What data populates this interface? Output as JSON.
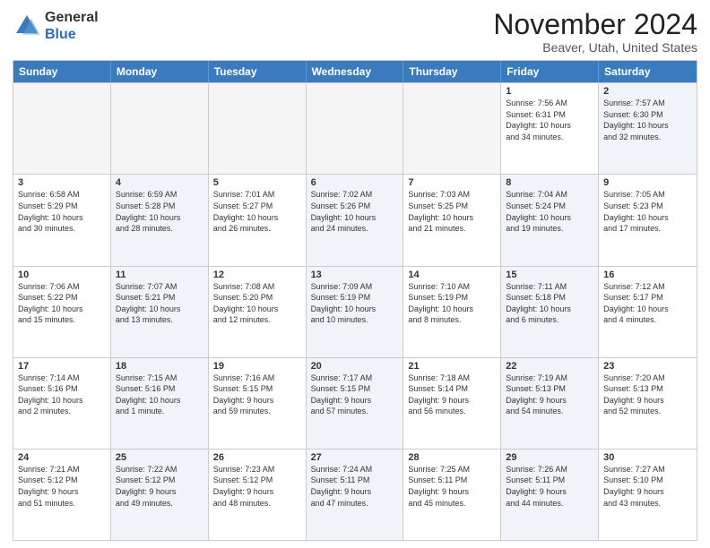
{
  "header": {
    "logo_general": "General",
    "logo_blue": "Blue",
    "month_title": "November 2024",
    "location": "Beaver, Utah, United States"
  },
  "weekdays": [
    "Sunday",
    "Monday",
    "Tuesday",
    "Wednesday",
    "Thursday",
    "Friday",
    "Saturday"
  ],
  "rows": [
    [
      {
        "day": "",
        "info": "",
        "empty": true
      },
      {
        "day": "",
        "info": "",
        "empty": true
      },
      {
        "day": "",
        "info": "",
        "empty": true
      },
      {
        "day": "",
        "info": "",
        "empty": true
      },
      {
        "day": "",
        "info": "",
        "empty": true
      },
      {
        "day": "1",
        "info": "Sunrise: 7:56 AM\nSunset: 6:31 PM\nDaylight: 10 hours\nand 34 minutes.",
        "empty": false,
        "alt": false
      },
      {
        "day": "2",
        "info": "Sunrise: 7:57 AM\nSunset: 6:30 PM\nDaylight: 10 hours\nand 32 minutes.",
        "empty": false,
        "alt": true
      }
    ],
    [
      {
        "day": "3",
        "info": "Sunrise: 6:58 AM\nSunset: 5:29 PM\nDaylight: 10 hours\nand 30 minutes.",
        "empty": false,
        "alt": false
      },
      {
        "day": "4",
        "info": "Sunrise: 6:59 AM\nSunset: 5:28 PM\nDaylight: 10 hours\nand 28 minutes.",
        "empty": false,
        "alt": true
      },
      {
        "day": "5",
        "info": "Sunrise: 7:01 AM\nSunset: 5:27 PM\nDaylight: 10 hours\nand 26 minutes.",
        "empty": false,
        "alt": false
      },
      {
        "day": "6",
        "info": "Sunrise: 7:02 AM\nSunset: 5:26 PM\nDaylight: 10 hours\nand 24 minutes.",
        "empty": false,
        "alt": true
      },
      {
        "day": "7",
        "info": "Sunrise: 7:03 AM\nSunset: 5:25 PM\nDaylight: 10 hours\nand 21 minutes.",
        "empty": false,
        "alt": false
      },
      {
        "day": "8",
        "info": "Sunrise: 7:04 AM\nSunset: 5:24 PM\nDaylight: 10 hours\nand 19 minutes.",
        "empty": false,
        "alt": true
      },
      {
        "day": "9",
        "info": "Sunrise: 7:05 AM\nSunset: 5:23 PM\nDaylight: 10 hours\nand 17 minutes.",
        "empty": false,
        "alt": false
      }
    ],
    [
      {
        "day": "10",
        "info": "Sunrise: 7:06 AM\nSunset: 5:22 PM\nDaylight: 10 hours\nand 15 minutes.",
        "empty": false,
        "alt": false
      },
      {
        "day": "11",
        "info": "Sunrise: 7:07 AM\nSunset: 5:21 PM\nDaylight: 10 hours\nand 13 minutes.",
        "empty": false,
        "alt": true
      },
      {
        "day": "12",
        "info": "Sunrise: 7:08 AM\nSunset: 5:20 PM\nDaylight: 10 hours\nand 12 minutes.",
        "empty": false,
        "alt": false
      },
      {
        "day": "13",
        "info": "Sunrise: 7:09 AM\nSunset: 5:19 PM\nDaylight: 10 hours\nand 10 minutes.",
        "empty": false,
        "alt": true
      },
      {
        "day": "14",
        "info": "Sunrise: 7:10 AM\nSunset: 5:19 PM\nDaylight: 10 hours\nand 8 minutes.",
        "empty": false,
        "alt": false
      },
      {
        "day": "15",
        "info": "Sunrise: 7:11 AM\nSunset: 5:18 PM\nDaylight: 10 hours\nand 6 minutes.",
        "empty": false,
        "alt": true
      },
      {
        "day": "16",
        "info": "Sunrise: 7:12 AM\nSunset: 5:17 PM\nDaylight: 10 hours\nand 4 minutes.",
        "empty": false,
        "alt": false
      }
    ],
    [
      {
        "day": "17",
        "info": "Sunrise: 7:14 AM\nSunset: 5:16 PM\nDaylight: 10 hours\nand 2 minutes.",
        "empty": false,
        "alt": false
      },
      {
        "day": "18",
        "info": "Sunrise: 7:15 AM\nSunset: 5:16 PM\nDaylight: 10 hours\nand 1 minute.",
        "empty": false,
        "alt": true
      },
      {
        "day": "19",
        "info": "Sunrise: 7:16 AM\nSunset: 5:15 PM\nDaylight: 9 hours\nand 59 minutes.",
        "empty": false,
        "alt": false
      },
      {
        "day": "20",
        "info": "Sunrise: 7:17 AM\nSunset: 5:15 PM\nDaylight: 9 hours\nand 57 minutes.",
        "empty": false,
        "alt": true
      },
      {
        "day": "21",
        "info": "Sunrise: 7:18 AM\nSunset: 5:14 PM\nDaylight: 9 hours\nand 56 minutes.",
        "empty": false,
        "alt": false
      },
      {
        "day": "22",
        "info": "Sunrise: 7:19 AM\nSunset: 5:13 PM\nDaylight: 9 hours\nand 54 minutes.",
        "empty": false,
        "alt": true
      },
      {
        "day": "23",
        "info": "Sunrise: 7:20 AM\nSunset: 5:13 PM\nDaylight: 9 hours\nand 52 minutes.",
        "empty": false,
        "alt": false
      }
    ],
    [
      {
        "day": "24",
        "info": "Sunrise: 7:21 AM\nSunset: 5:12 PM\nDaylight: 9 hours\nand 51 minutes.",
        "empty": false,
        "alt": false
      },
      {
        "day": "25",
        "info": "Sunrise: 7:22 AM\nSunset: 5:12 PM\nDaylight: 9 hours\nand 49 minutes.",
        "empty": false,
        "alt": true
      },
      {
        "day": "26",
        "info": "Sunrise: 7:23 AM\nSunset: 5:12 PM\nDaylight: 9 hours\nand 48 minutes.",
        "empty": false,
        "alt": false
      },
      {
        "day": "27",
        "info": "Sunrise: 7:24 AM\nSunset: 5:11 PM\nDaylight: 9 hours\nand 47 minutes.",
        "empty": false,
        "alt": true
      },
      {
        "day": "28",
        "info": "Sunrise: 7:25 AM\nSunset: 5:11 PM\nDaylight: 9 hours\nand 45 minutes.",
        "empty": false,
        "alt": false
      },
      {
        "day": "29",
        "info": "Sunrise: 7:26 AM\nSunset: 5:11 PM\nDaylight: 9 hours\nand 44 minutes.",
        "empty": false,
        "alt": true
      },
      {
        "day": "30",
        "info": "Sunrise: 7:27 AM\nSunset: 5:10 PM\nDaylight: 9 hours\nand 43 minutes.",
        "empty": false,
        "alt": false
      }
    ]
  ]
}
